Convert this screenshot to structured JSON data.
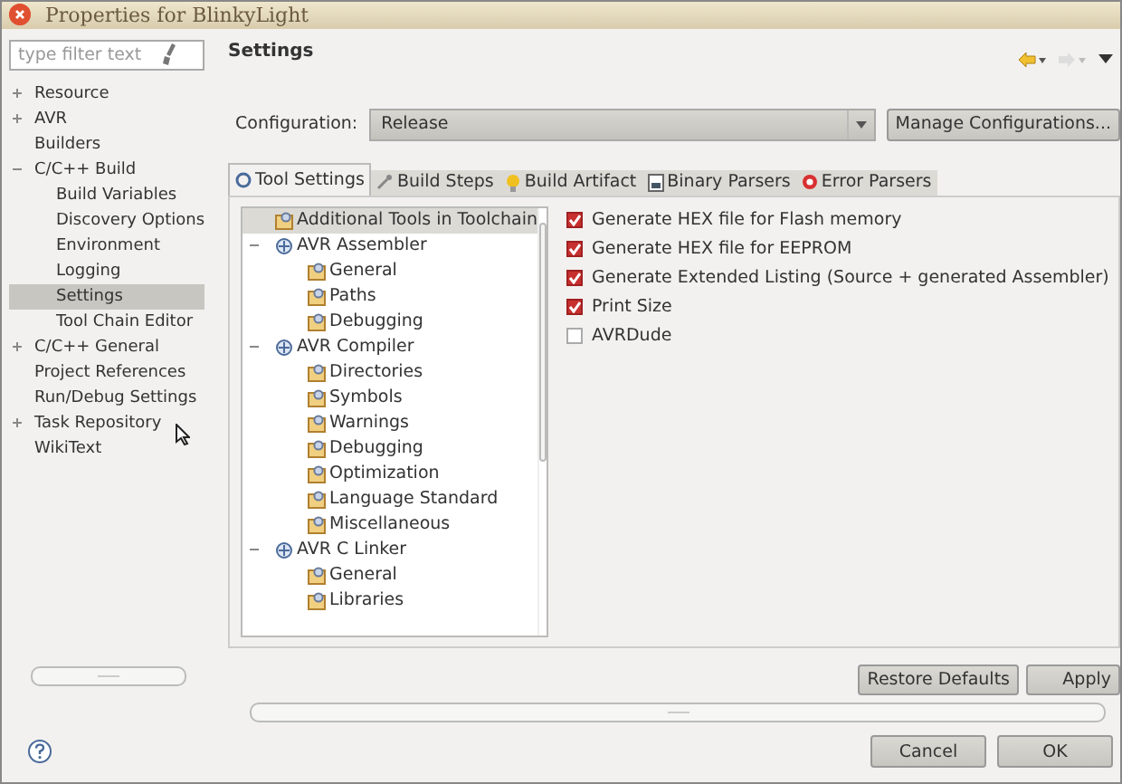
{
  "window": {
    "title": "Properties for BlinkyLight"
  },
  "filter": {
    "placeholder": "type filter text"
  },
  "sidebar": {
    "items": [
      {
        "label": "Resource",
        "expanded": false,
        "selected": false
      },
      {
        "label": "AVR",
        "expanded": false,
        "selected": false
      },
      {
        "label": "Builders",
        "selected": false
      },
      {
        "label": "C/C++ Build",
        "expanded": true,
        "selected": false,
        "children": [
          {
            "label": "Build Variables",
            "selected": false
          },
          {
            "label": "Discovery Options",
            "selected": false
          },
          {
            "label": "Environment",
            "selected": false
          },
          {
            "label": "Logging",
            "selected": false
          },
          {
            "label": "Settings",
            "selected": true
          },
          {
            "label": "Tool Chain Editor",
            "selected": false
          }
        ]
      },
      {
        "label": "C/C++ General",
        "expanded": false,
        "selected": false
      },
      {
        "label": "Project References",
        "selected": false
      },
      {
        "label": "Run/Debug Settings",
        "selected": false
      },
      {
        "label": "Task Repository",
        "expanded": false,
        "selected": false
      },
      {
        "label": "WikiText",
        "selected": false
      }
    ]
  },
  "page_title": "Settings",
  "configuration": {
    "label": "Configuration:",
    "value": "Release",
    "manage_button": "Manage Configurations..."
  },
  "tabs": [
    {
      "label": "Tool Settings",
      "selected": true
    },
    {
      "label": "Build Steps",
      "selected": false
    },
    {
      "label": "Build Artifact",
      "selected": false
    },
    {
      "label": "Binary Parsers",
      "selected": false
    },
    {
      "label": "Error Parsers",
      "selected": false
    }
  ],
  "tool_tree": [
    {
      "label": "Additional Tools in Toolchain",
      "selected": true
    },
    {
      "label": "AVR Assembler",
      "expanded": true,
      "selected": false,
      "children": [
        {
          "label": "General",
          "selected": false
        },
        {
          "label": "Paths",
          "selected": false
        },
        {
          "label": "Debugging",
          "selected": false
        }
      ]
    },
    {
      "label": "AVR Compiler",
      "expanded": true,
      "selected": false,
      "children": [
        {
          "label": "Directories",
          "selected": false
        },
        {
          "label": "Symbols",
          "selected": false
        },
        {
          "label": "Warnings",
          "selected": false
        },
        {
          "label": "Debugging",
          "selected": false
        },
        {
          "label": "Optimization",
          "selected": false
        },
        {
          "label": "Language Standard",
          "selected": false
        },
        {
          "label": "Miscellaneous",
          "selected": false
        }
      ]
    },
    {
      "label": "AVR C Linker",
      "expanded": true,
      "selected": false,
      "children": [
        {
          "label": "General",
          "selected": false
        },
        {
          "label": "Libraries",
          "selected": false
        }
      ]
    }
  ],
  "options": [
    {
      "label": "Generate HEX file for Flash memory",
      "checked": true
    },
    {
      "label": "Generate HEX file for EEPROM",
      "checked": true
    },
    {
      "label": "Generate Extended Listing (Source + generated Assembler)",
      "checked": true
    },
    {
      "label": "Print Size",
      "checked": true
    },
    {
      "label": "AVRDude",
      "checked": false
    }
  ],
  "page_buttons": [
    "Restore Defaults",
    "Apply"
  ],
  "dialog_buttons": [
    "Cancel",
    "OK"
  ]
}
